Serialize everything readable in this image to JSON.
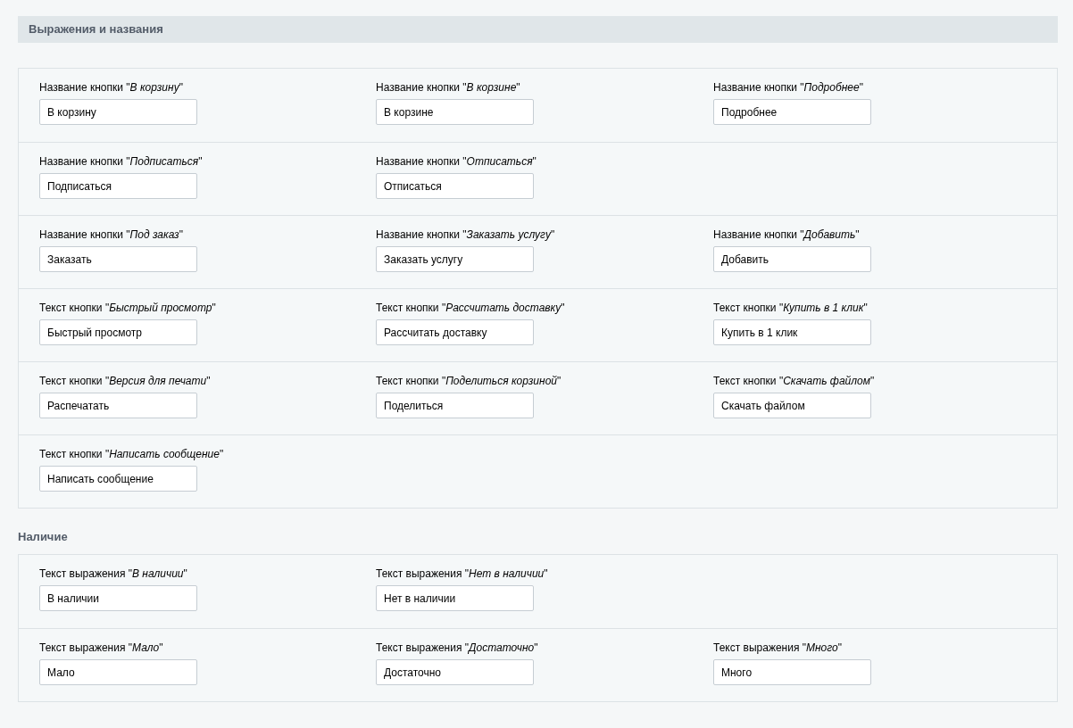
{
  "sections": [
    {
      "title": "Выражения и названия",
      "kind": "bar",
      "rows": [
        [
          {
            "label": "Название кнопки \"*В корзину*\"",
            "value": "В корзину"
          },
          {
            "label": "Название кнопки \"*В корзине*\"",
            "value": "В корзине"
          },
          {
            "label": "Название кнопки \"*Подробнее*\"",
            "value": "Подробнее"
          }
        ],
        [
          {
            "label": "Название кнопки \"*Подписаться*\"",
            "value": "Подписаться"
          },
          {
            "label": "Название кнопки \"*Отписаться*\"",
            "value": "Отписаться"
          }
        ],
        [
          {
            "label": "Название кнопки \"*Под заказ*\"",
            "value": "Заказать"
          },
          {
            "label": "Название кнопки \"*Заказать услугу*\"",
            "value": "Заказать услугу"
          },
          {
            "label": "Название кнопки \"*Добавить*\"",
            "value": "Добавить"
          }
        ],
        [
          {
            "label": "Текст кнопки \"*Быстрый просмотр*\"",
            "value": "Быстрый просмотр"
          },
          {
            "label": "Текст кнопки \"*Рассчитать доставку*\"",
            "value": "Рассчитать доставку"
          },
          {
            "label": "Текст кнопки \"*Купить в 1 клик*\"",
            "value": "Купить в 1 клик"
          }
        ],
        [
          {
            "label": "Текст кнопки \"*Версия для печати*\"",
            "value": "Распечатать"
          },
          {
            "label": "Текст кнопки \"*Поделиться корзиной*\"",
            "value": "Поделиться"
          },
          {
            "label": "Текст кнопки \"*Скачать файлом*\"",
            "value": "Скачать файлом"
          }
        ],
        [
          {
            "label": "Текст кнопки \"*Написать сообщение*\"",
            "value": "Написать сообщение"
          }
        ]
      ]
    },
    {
      "title": "Наличие",
      "kind": "plain",
      "rows": [
        [
          {
            "label": "Текст выражения \"*В наличии*\"",
            "value": "В наличии"
          },
          {
            "label": "Текст выражения \"*Нет в наличии*\"",
            "value": "Нет в наличии"
          }
        ],
        [
          {
            "label": "Текст выражения \"*Мало*\"",
            "value": "Мало"
          },
          {
            "label": "Текст выражения \"*Достаточно*\"",
            "value": "Достаточно"
          },
          {
            "label": "Текст выражения \"*Много*\"",
            "value": "Много"
          }
        ]
      ]
    }
  ]
}
